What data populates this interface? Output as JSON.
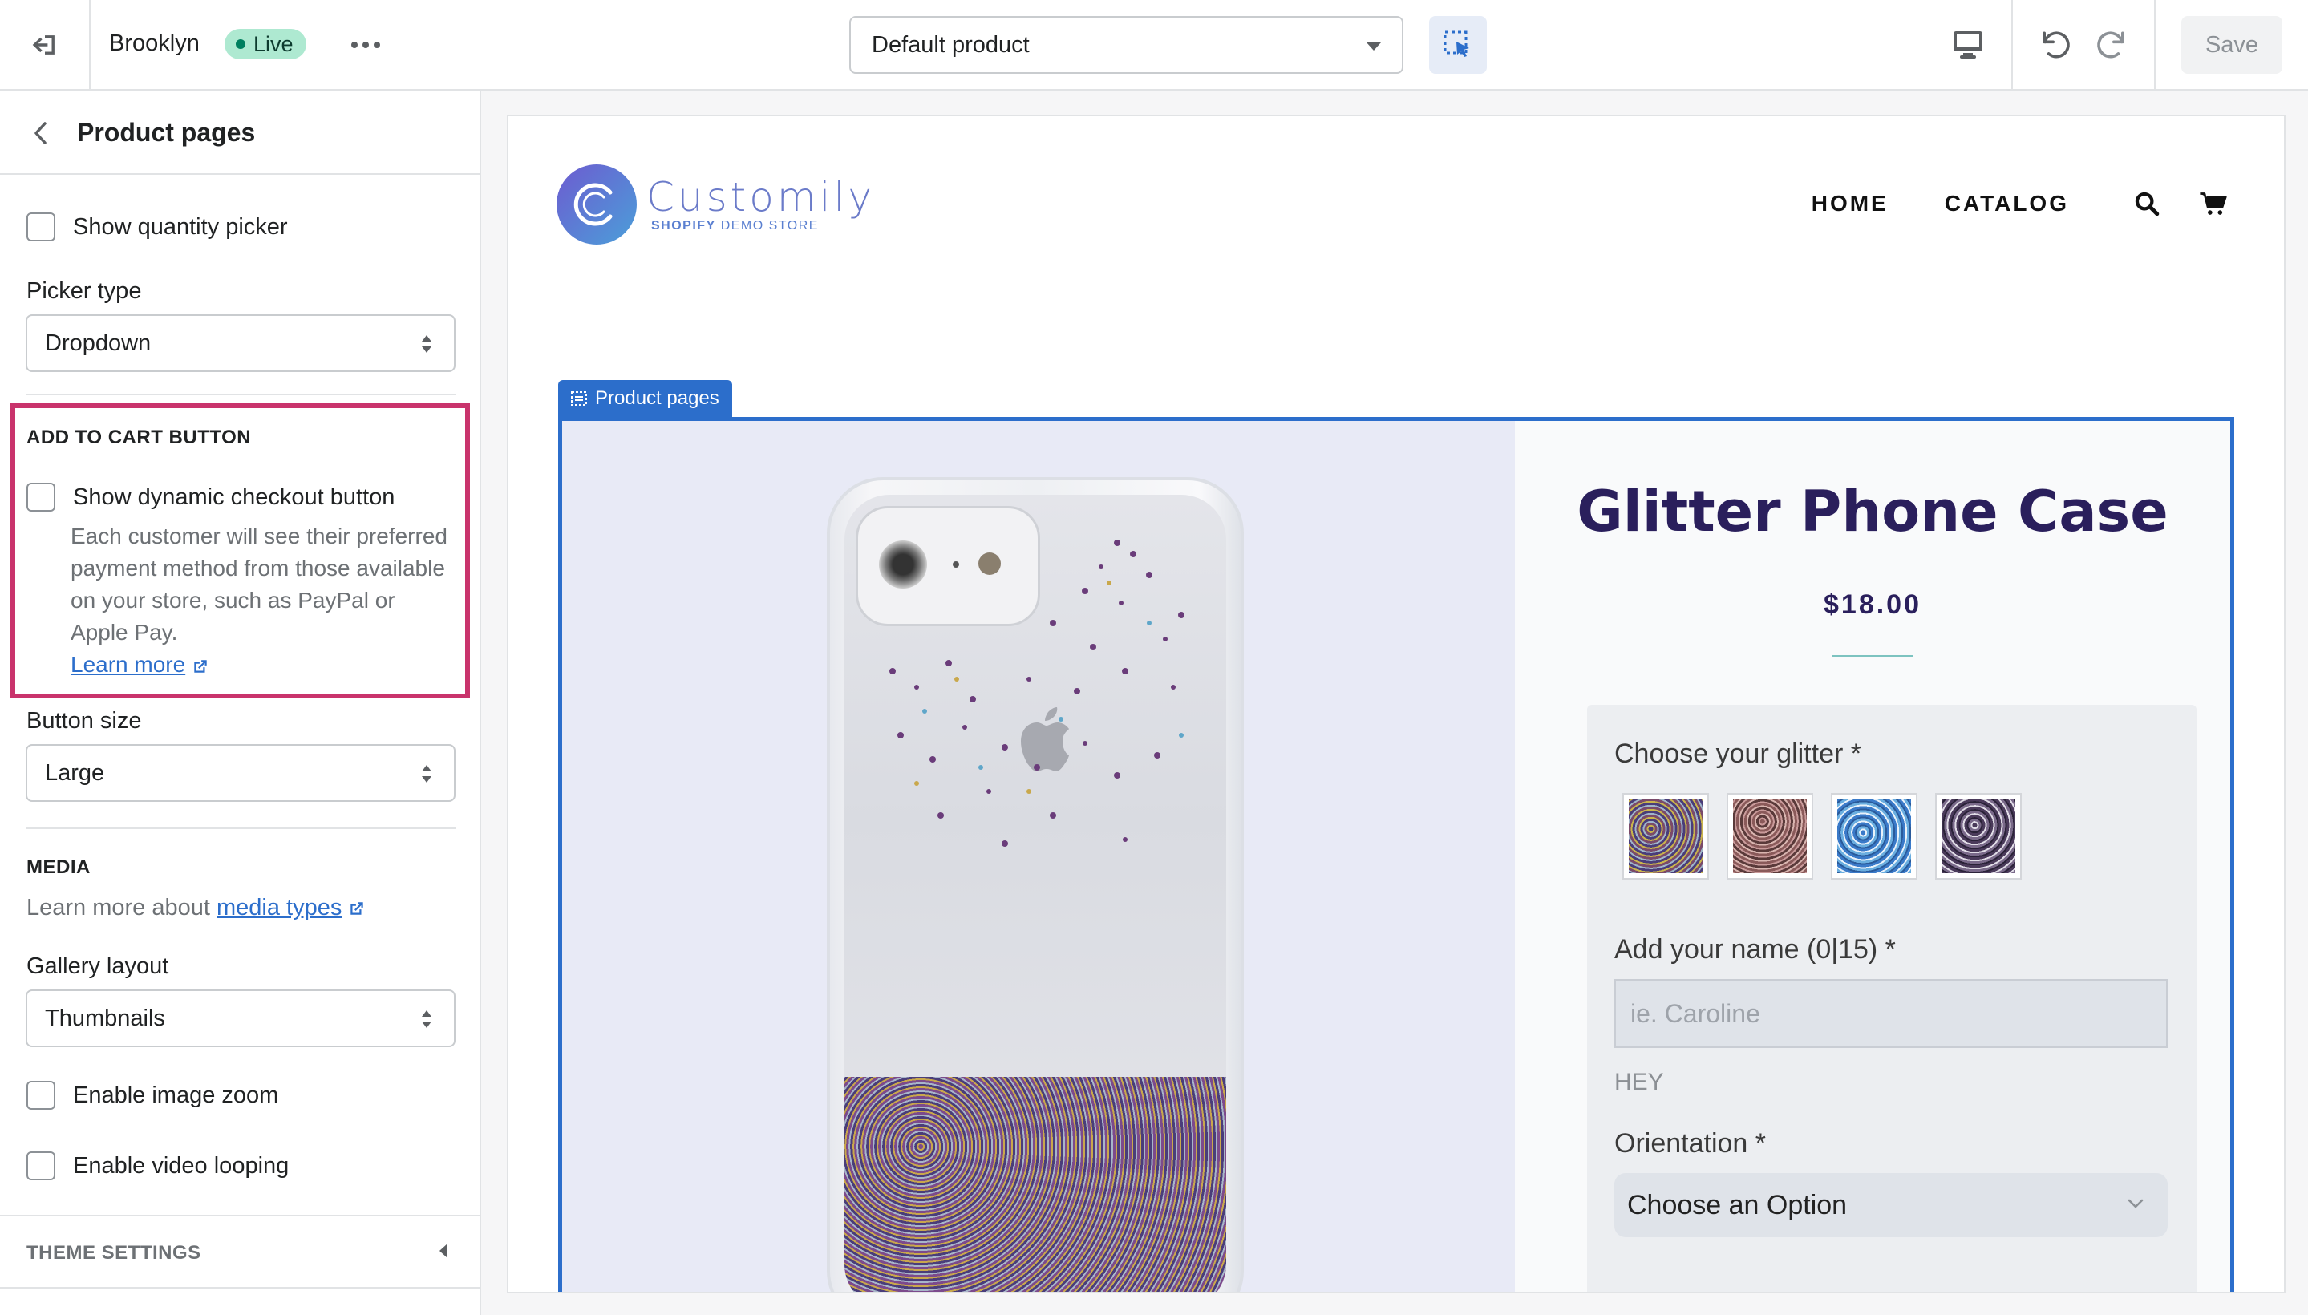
{
  "topbar": {
    "theme_name": "Brooklyn",
    "live_badge": "Live",
    "template_select": "Default product",
    "save_label": "Save"
  },
  "sidebar": {
    "title": "Product pages",
    "show_quantity_picker": "Show quantity picker",
    "picker_type_label": "Picker type",
    "picker_type_value": "Dropdown",
    "add_to_cart_heading": "ADD TO CART BUTTON",
    "dynamic_checkout_label": "Show dynamic checkout button",
    "dynamic_checkout_help": "Each customer will see their preferred payment method from those available on your store, such as PayPal or Apple Pay.",
    "learn_more": "Learn more",
    "button_size_label": "Button size",
    "button_size_value": "Large",
    "media_heading": "MEDIA",
    "media_text": "Learn more about",
    "media_link": "media types",
    "gallery_layout_label": "Gallery layout",
    "gallery_layout_value": "Thumbnails",
    "enable_zoom": "Enable image zoom",
    "enable_looping": "Enable video looping",
    "theme_settings": "THEME SETTINGS"
  },
  "store": {
    "logo_name": "Customily",
    "logo_sub_bold": "SHOPIFY",
    "logo_sub_rest": "DEMO STORE",
    "nav_home": "HOME",
    "nav_catalog": "CATALOG"
  },
  "section_tag": "Product pages",
  "product": {
    "title": "Glitter Phone Case",
    "price": "$18.00",
    "glitter_label": "Choose your glitter *",
    "name_label": "Add your name (0|15) *",
    "name_placeholder": "ie. Caroline",
    "name_preview": "HEY",
    "orientation_label": "Orientation *",
    "orientation_value": "Choose an Option"
  },
  "colors": {
    "accent": "#2c6ecb",
    "highlight": "#c9336c",
    "live_badge_bg": "#aee9d1",
    "product_title": "#2a1f5c"
  }
}
